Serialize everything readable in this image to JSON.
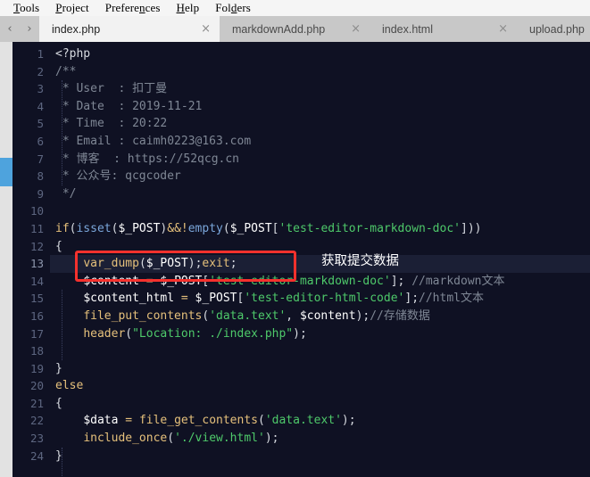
{
  "menu": {
    "items": [
      {
        "label": "Tools",
        "accel": "T"
      },
      {
        "label": "Project",
        "accel": "P"
      },
      {
        "label": "Preferences",
        "accel": "n"
      },
      {
        "label": "Help",
        "accel": "H"
      },
      {
        "label": "Folders",
        "accel": "d"
      }
    ]
  },
  "nav": {
    "back_icon": "‹",
    "forward_icon": "›"
  },
  "tabs": [
    {
      "label": "index.php",
      "active": true,
      "close_icon": "×"
    },
    {
      "label": "markdownAdd.php",
      "active": false,
      "close_icon": "×"
    },
    {
      "label": "index.html",
      "active": false,
      "close_icon": "×"
    },
    {
      "label": "upload.php",
      "active": false,
      "close_icon": ""
    }
  ],
  "editor": {
    "language": "php",
    "current_line": 13,
    "first_line": 1,
    "last_line": 24,
    "line_numbers": [
      1,
      2,
      3,
      4,
      5,
      6,
      7,
      8,
      9,
      10,
      11,
      12,
      13,
      14,
      15,
      16,
      17,
      18,
      19,
      20,
      21,
      22,
      23,
      24
    ],
    "annotation_text": "获取提交数据",
    "colors": {
      "background": "#0f1123",
      "current_line_bg": "#1b1f35",
      "gutter_text": "#5d6680",
      "keyword": "#e5c07b",
      "function": "#7aa6da",
      "string": "#4ec96a",
      "comment": "#7f8795",
      "variable": "#ffffff",
      "default": "#d7dae0",
      "highlight_box": "#f5312d",
      "scroll_marker": "#4ea3dd"
    },
    "lines": [
      {
        "n": 1,
        "text": "<?php"
      },
      {
        "n": 2,
        "text": "/**"
      },
      {
        "n": 3,
        "text": " * User  : 扣丁曼"
      },
      {
        "n": 4,
        "text": " * Date  : 2019-11-21"
      },
      {
        "n": 5,
        "text": " * Time  : 20:22"
      },
      {
        "n": 6,
        "text": " * Email : caimh0223@163.com"
      },
      {
        "n": 7,
        "text": " * 博客  : https://52qcg.cn"
      },
      {
        "n": 8,
        "text": " * 公众号: qcgcoder"
      },
      {
        "n": 9,
        "text": " */"
      },
      {
        "n": 10,
        "text": ""
      },
      {
        "n": 11,
        "text": "if(isset($_POST)&&!empty($_POST['test-editor-markdown-doc']))"
      },
      {
        "n": 12,
        "text": "{"
      },
      {
        "n": 13,
        "text": "    var_dump($_POST);exit;"
      },
      {
        "n": 14,
        "text": "    $content = $_POST['test-editor-markdown-doc']; //markdown文本"
      },
      {
        "n": 15,
        "text": "    $content_html = $_POST['test-editor-html-code'];//html文本"
      },
      {
        "n": 16,
        "text": "    file_put_contents('data.text', $content);//存储数据"
      },
      {
        "n": 17,
        "text": "    header(\"Location: ./index.php\");"
      },
      {
        "n": 18,
        "text": ""
      },
      {
        "n": 19,
        "text": "}"
      },
      {
        "n": 20,
        "text": "else"
      },
      {
        "n": 21,
        "text": "{"
      },
      {
        "n": 22,
        "text": "    $data = file_get_contents('data.text');"
      },
      {
        "n": 23,
        "text": "    include_once('./view.html');"
      },
      {
        "n": 24,
        "text": "}"
      }
    ]
  }
}
